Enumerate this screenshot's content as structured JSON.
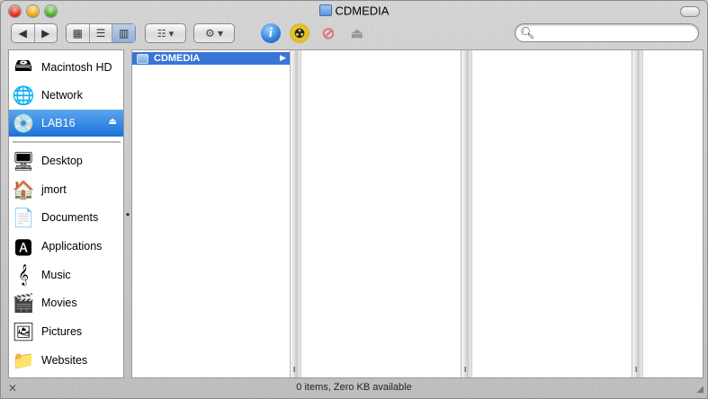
{
  "window": {
    "title": "CDMEDIA"
  },
  "toolbar": {
    "back_icon": "◀",
    "forward_icon": "▶",
    "view_icons": [
      "▦",
      "☰",
      "▥"
    ],
    "arrange_icon": "☷ ▾",
    "action_icon": "⚙ ▾",
    "info_icon": "i",
    "burn_icon": "☢",
    "stop_icon": "⊘",
    "eject_icon": "⏏"
  },
  "search": {
    "placeholder": "",
    "value": ""
  },
  "sidebar": {
    "devices": [
      {
        "label": "Macintosh HD",
        "icon": "🖴"
      },
      {
        "label": "Network",
        "icon": "🌐"
      },
      {
        "label": "LAB16",
        "icon": "💿",
        "selected": true,
        "eject": "⏏"
      }
    ],
    "places": [
      {
        "label": "Desktop",
        "icon": "🖥"
      },
      {
        "label": "jmort",
        "icon": "🏠"
      },
      {
        "label": "Documents",
        "icon": "📄"
      },
      {
        "label": "Applications",
        "icon": "🅰"
      },
      {
        "label": "Music",
        "icon": "𝄞"
      },
      {
        "label": "Movies",
        "icon": "🎬"
      },
      {
        "label": "Pictures",
        "icon": "🖼"
      },
      {
        "label": "Websites",
        "icon": "📁"
      }
    ]
  },
  "browser": {
    "column1": [
      {
        "label": "CDMEDIA",
        "selected": true,
        "has_children": true,
        "arrow": "▶"
      }
    ],
    "grip": "ll"
  },
  "status": {
    "text": "0 items, Zero KB available"
  },
  "colors": {
    "selection": "#3875d7",
    "sidebar_selection": "#1b73d8"
  }
}
